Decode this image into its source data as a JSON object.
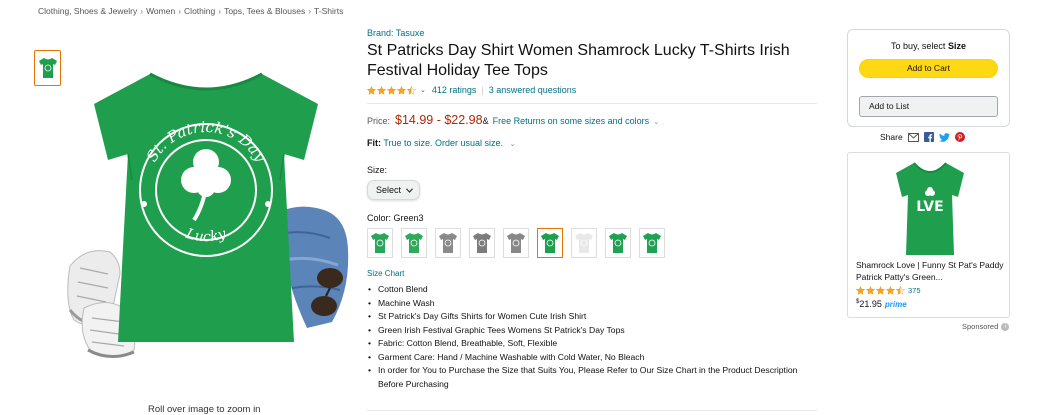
{
  "breadcrumb": [
    "Clothing, Shoes & Jewelry",
    "Women",
    "Clothing",
    "Tops, Tees & Blouses",
    "T-Shirts"
  ],
  "breadcrumb_sep": "›",
  "image": {
    "shirt_color": "#1f9f4e",
    "print_top": "St. Patrick's Day",
    "print_bottom": "Lucky",
    "zoom_hint": "Roll over image to zoom in"
  },
  "product": {
    "brand": "Brand: Tasuxe",
    "title": "St Patricks Day Shirt Women Shamrock Lucky T-Shirts Irish Festival Holiday Tee Tops",
    "rating_stars": 4.5,
    "ratings_count": "412 ratings",
    "answered": "3 answered questions",
    "price_label": "Price:",
    "price": "$14.99 - $22.98",
    "price_suffix": "&",
    "free_returns": "Free Returns on some sizes and colors",
    "fit_label": "Fit:",
    "fit_text": "True to size. Order usual size.",
    "size_label": "Size:",
    "size_select": "Select",
    "color_label": "Color: Green3",
    "size_chart": "Size Chart",
    "bullets": [
      "Cotton Blend",
      "Machine Wash",
      "St Patrick's Day Gifts Shirts for Women Cute Irish Shirt",
      "Green Irish Festival Graphic Tees Womens St Patrick's Day Tops",
      "Fabric: Cotton Blend, Breathable, Soft, Flexible",
      "Garment Care: Hand / Machine Washable with Cold Water, No Bleach",
      "In order for You to Purchase the Size that Suits You, Please Refer to Our Size Chart in the Product Description Before Purchasing"
    ]
  },
  "swatches": [
    {
      "name": "green-1",
      "color": "#2aa55a"
    },
    {
      "name": "green-2",
      "color": "#32a85c"
    },
    {
      "name": "grey-1",
      "color": "#8a8a8a"
    },
    {
      "name": "grey-2",
      "color": "#7c7c7c"
    },
    {
      "name": "grey-3",
      "color": "#888888"
    },
    {
      "name": "green-3",
      "color": "#1f9f4e",
      "selected": true
    },
    {
      "name": "white-1",
      "color": "#e8e8e8"
    },
    {
      "name": "green-4",
      "color": "#22a153"
    },
    {
      "name": "green-5",
      "color": "#1fa254"
    }
  ],
  "buybox": {
    "prompt": "To buy, select",
    "prompt_bold": "Size",
    "add_to_cart": "Add to Cart",
    "add_to_list": "Add to List",
    "accent": "#ffd814"
  },
  "share": {
    "label": "Share"
  },
  "ad": {
    "title": "Shamrock Love | Funny St Pat's Paddy Patrick Patty's Green...",
    "rating_count": "375",
    "price": "21.95",
    "currency": "$",
    "prime": "prime",
    "sponsored": "Sponsored",
    "print": "LVE"
  }
}
